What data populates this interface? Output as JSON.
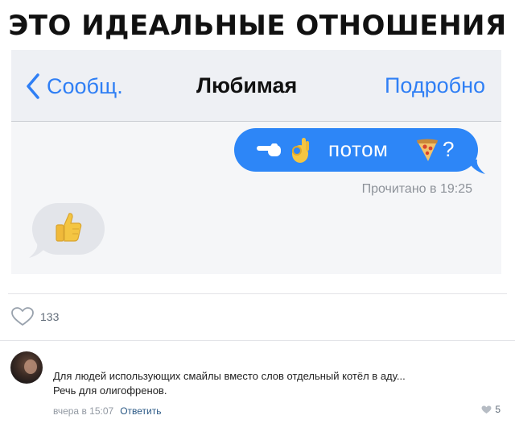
{
  "meme": {
    "title": "ЭТО ИДЕАЛЬНЫЕ ОТНОШЕНИЯ"
  },
  "chat": {
    "nav": {
      "back_label": "Сообщ.",
      "contact_name": "Любимая",
      "details_label": "Подробно"
    },
    "outgoing_message": {
      "emojis": [
        "pointing-hand",
        "ok-hand",
        "pizza"
      ],
      "text": "потом",
      "punctuation": "?"
    },
    "read_receipt": "Прочитано в 19:25",
    "incoming_message": {
      "emoji": "thumbs-up"
    },
    "colors": {
      "bubble_out": "#2d86f7",
      "bubble_in": "#e3e5ea",
      "ios_blue": "#2f7ff5"
    }
  },
  "post": {
    "likes": "133",
    "like_icon": "heart-outline-icon"
  },
  "comment": {
    "lines": [
      "Для людей использующих смайлы вместо слов отдельный котёл в аду...",
      "Речь для олигофренов."
    ],
    "time": "вчера в 15:07",
    "reply_label": "Ответить",
    "likes": "5",
    "link_color": "#2a5885"
  }
}
